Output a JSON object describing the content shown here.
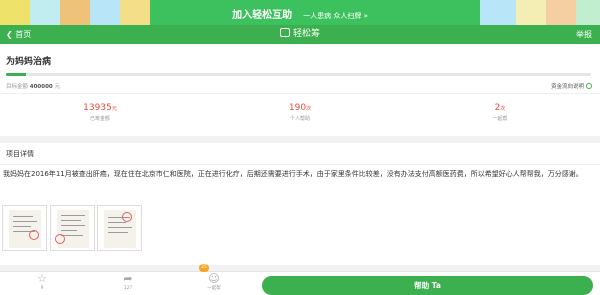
{
  "banner": {
    "main": "加入轻松互助",
    "sub": "一人患病  众人扫牌 »"
  },
  "nav": {
    "back_label": "首页",
    "brand": "轻松筹",
    "report_label": "举报"
  },
  "project": {
    "title": "为妈妈治病",
    "progress_fraction": 0.035,
    "target_label": "目标金额",
    "target_amount": "400000",
    "target_unit": "元",
    "fund_note": "资金流向说明"
  },
  "stats": [
    {
      "value": "13935",
      "unit": "元",
      "label": "已筹金额"
    },
    {
      "value": "190",
      "unit": "次",
      "label": "个人帮助"
    },
    {
      "value": "2",
      "unit": "次",
      "label": "一起帮"
    }
  ],
  "details": {
    "heading": "项目详情",
    "story": "我妈妈在2016年11月被查出肝癌，现在住在北京市仁和医院，正在进行化疗，后期还需要进行手术，由于家里条件比较差，没有办法支付高额医药费，所以希望好心人帮帮我，万分感谢。"
  },
  "bottom": {
    "like_count": "9",
    "share_count": "127",
    "together_label": "一起帮",
    "badge_count": "25",
    "help_button": "帮助 Ta"
  },
  "colors": {
    "brand_green": "#3cb04f",
    "amount_red": "#e84a3c"
  },
  "icons": [
    "back-chevron-icon",
    "brand-logo-icon",
    "info-icon",
    "star-icon",
    "share-icon",
    "user-icon"
  ]
}
